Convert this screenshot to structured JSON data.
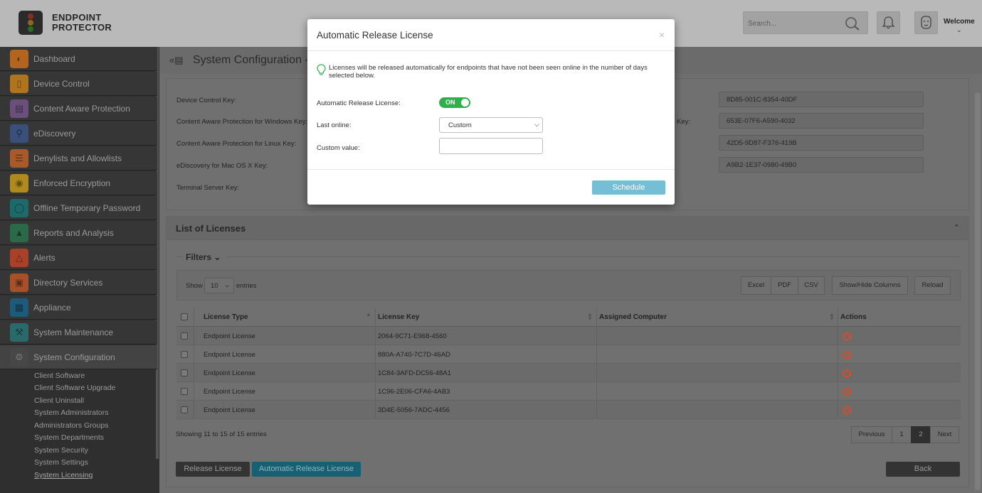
{
  "brand": {
    "line1": "ENDPOINT",
    "line2": "PROTECTOR"
  },
  "header": {
    "search_placeholder": "Search...",
    "welcome": "Welcome"
  },
  "sidebar": {
    "items": [
      {
        "label": "Dashboard",
        "icon": "dashboard-icon",
        "color": "#b3641e"
      },
      {
        "label": "Device Control",
        "icon": "usb-icon",
        "color": "#b0741e"
      },
      {
        "label": "Content Aware Protection",
        "icon": "document-scan-icon",
        "color": "#6a4f7a"
      },
      {
        "label": "eDiscovery",
        "icon": "magnifier-icon",
        "color": "#3a4f7a"
      },
      {
        "label": "Denylists and Allowlists",
        "icon": "list-icon",
        "color": "#a85a2a"
      },
      {
        "label": "Enforced Encryption",
        "icon": "lock-icon",
        "color": "#b08a1e"
      },
      {
        "label": "Offline Temporary Password",
        "icon": "shield-icon",
        "color": "#1e6a6a"
      },
      {
        "label": "Reports and Analysis",
        "icon": "chart-icon",
        "color": "#2a6a4a"
      },
      {
        "label": "Alerts",
        "icon": "alert-icon",
        "color": "#a8402a"
      },
      {
        "label": "Directory Services",
        "icon": "directory-icon",
        "color": "#a8502a"
      },
      {
        "label": "Appliance",
        "icon": "appliance-icon",
        "color": "#1e5a7a"
      },
      {
        "label": "System Maintenance",
        "icon": "tools-icon",
        "color": "#2a6a6a"
      },
      {
        "label": "System Configuration",
        "icon": "gear-icon",
        "color": "#474747"
      }
    ],
    "subitems": [
      "Client Software",
      "Client Software Upgrade",
      "Client Uninstall",
      "System Administrators",
      "Administrators Groups",
      "System Departments",
      "System Security",
      "System Settings",
      "System Licensing"
    ]
  },
  "page": {
    "title": "System Configuration -"
  },
  "keys": {
    "left_labels": [
      "Device Control Key:",
      "Content Aware Protection for Windows Key:",
      "Content Aware Protection for Linux Key:",
      "eDiscovery for Mac OS X Key:",
      "Terminal Server Key:"
    ],
    "right_label_fragment": "Key:",
    "right_values": [
      "8D85-001C-8354-40DF",
      "653E-07F6-A590-4032",
      "42D5-9D87-F376-419B",
      "A9B2-1E37-0980-49B0"
    ]
  },
  "licenses": {
    "title": "List of Licenses",
    "filters_label": "Filters",
    "show_label": "Show",
    "entries_label": "entries",
    "page_size": "10",
    "toolbar_buttons": [
      "Excel",
      "PDF",
      "CSV",
      "Show/Hide Columns",
      "Reload"
    ],
    "columns": [
      "License Type",
      "License Key",
      "Assigned Computer",
      "Actions"
    ],
    "rows": [
      {
        "type": "Endpoint License",
        "key": "2064-9C71-E968-4560",
        "computer": ""
      },
      {
        "type": "Endpoint License",
        "key": "880A-A740-7C7D-46AD",
        "computer": ""
      },
      {
        "type": "Endpoint License",
        "key": "1C84-3AFD-DC56-48A1",
        "computer": ""
      },
      {
        "type": "Endpoint License",
        "key": "1C96-2E06-CFA6-4AB3",
        "computer": ""
      },
      {
        "type": "Endpoint License",
        "key": "3D4E-5056-7ADC-4456",
        "computer": ""
      }
    ],
    "showing_text": "Showing 11 to 15 of 15 entries",
    "pagination": {
      "previous": "Previous",
      "pages": [
        "1",
        "2"
      ],
      "current": "2",
      "next": "Next"
    }
  },
  "footer_buttons": {
    "release": "Release License",
    "auto_release": "Automatic Release License",
    "back": "Back"
  },
  "modal": {
    "title": "Automatic Release License",
    "close": "×",
    "info": "Licenses will be released automatically for endpoints that have not been seen online in the number of days selected below.",
    "auto_release_label": "Automatic Release License:",
    "toggle_state": "ON",
    "last_online_label": "Last online:",
    "last_online_value": "Custom",
    "custom_value_label": "Custom value:",
    "custom_value": "",
    "schedule_button": "Schedule"
  },
  "colors": {
    "toggle_on": "#2fb04a",
    "schedule_button": "#74bed6",
    "action_icon": "#e04a1e",
    "teal_button": "#175f72"
  }
}
